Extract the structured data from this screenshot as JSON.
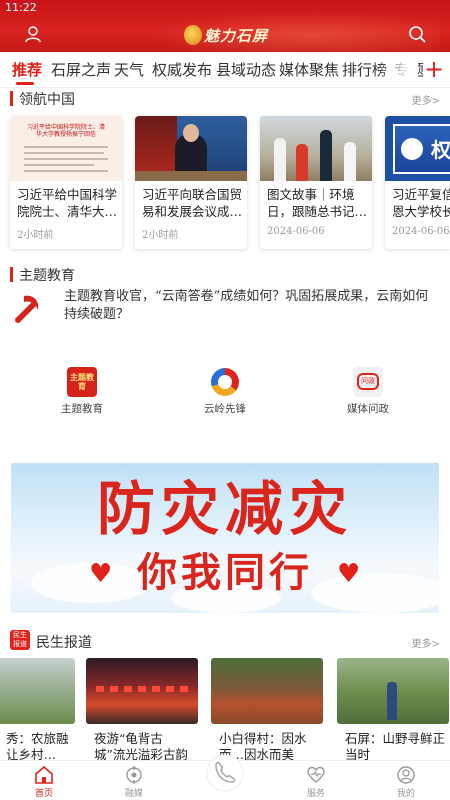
{
  "status_bar": {
    "time": "11:22"
  },
  "header": {
    "app_name": "魅力石屏",
    "brand_color": "#d9231f"
  },
  "tabs": [
    {
      "label": "推荐",
      "active": true
    },
    {
      "label": "石屏之声"
    },
    {
      "label": "天气"
    },
    {
      "label": "权威发布"
    },
    {
      "label": "县域动态"
    },
    {
      "label": "媒体聚焦"
    },
    {
      "label": "排行榜"
    },
    {
      "label": "专题"
    }
  ],
  "section_lingdao": {
    "title": "领航中国",
    "more": "更多>",
    "cards": [
      {
        "thumb_text": "习近平给中国科学院院士、清华大学教授杨振宁回信",
        "title": "习近平给中国科学院院士、清华大…",
        "time": "2小时前"
      },
      {
        "title": "习近平向联合国贸易和发展会议成…",
        "time": "2小时前"
      },
      {
        "title": "图文故事｜环境日，跟随总书记…",
        "time": "2024-06-06"
      },
      {
        "thumb_text": "权威",
        "title": "习近平复信美国…恩大学校长",
        "time": "2024-06-06"
      }
    ]
  },
  "section_theme": {
    "title": "主题教育",
    "headline": "主题教育收官，“云南答卷”成绩如何？巩固拓展成果，云南如何持续破题？"
  },
  "quick_links": [
    {
      "label": "主题教育",
      "icon_text": "主题教育"
    },
    {
      "label": "云岭先锋"
    },
    {
      "label": "媒体问政",
      "icon_text": "问政"
    }
  ],
  "banner": {
    "line1": "防灾减灾",
    "line2": "你我同行"
  },
  "section_minsheng": {
    "title": "民生报道",
    "icon_text": "民生报道",
    "more": "更多>",
    "cards": [
      {
        "title": "秀：农旅融让乡村…"
      },
      {
        "title": "夜游“龟背古城”流光溢彩古韵浓"
      },
      {
        "title": "小白得村：因水而…因水而美"
      },
      {
        "title": "石屏：山野寻鲜正当时"
      }
    ]
  },
  "bottom_nav": [
    {
      "label": "首页",
      "icon": "home-icon",
      "active": true
    },
    {
      "label": "融媒",
      "icon": "media-icon"
    },
    {
      "label": "",
      "icon": "hotline-icon"
    },
    {
      "label": "服务",
      "icon": "service-icon"
    },
    {
      "label": "我的",
      "icon": "profile-icon"
    }
  ]
}
